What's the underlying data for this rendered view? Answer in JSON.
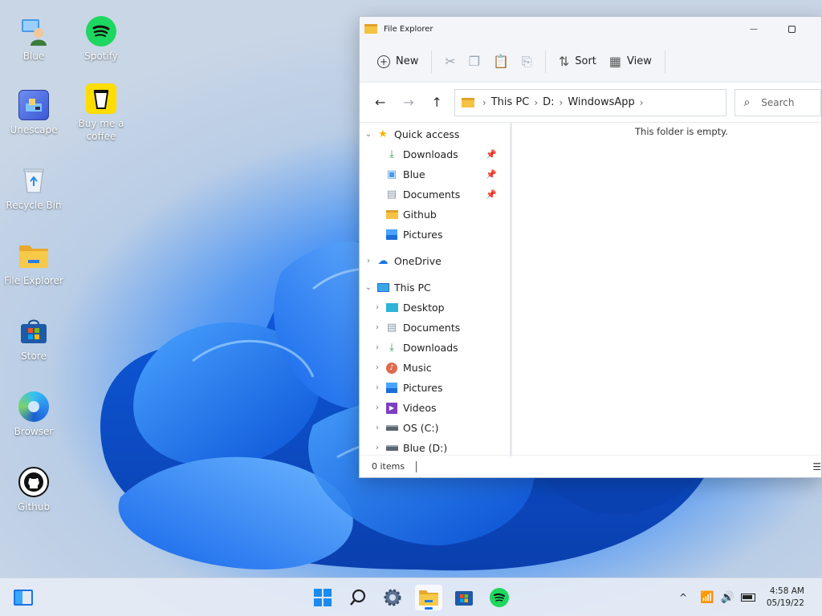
{
  "desktop": {
    "icons": [
      {
        "label": "Blue"
      },
      {
        "label": "Spotify"
      },
      {
        "label": "Unescape"
      },
      {
        "label": "Buy me a coffee"
      },
      {
        "label": "Recycle Bin"
      },
      {
        "label": "File Explorer"
      },
      {
        "label": "Store"
      },
      {
        "label": "Browser"
      },
      {
        "label": "Github"
      }
    ]
  },
  "explorer": {
    "title": "File Explorer",
    "toolbar": {
      "new": "New",
      "sort": "Sort",
      "view": "View"
    },
    "path": [
      "This PC",
      "D:",
      "WindowsApp"
    ],
    "search_placeholder": "Search",
    "quick_access": {
      "label": "Quick access",
      "items": [
        {
          "label": "Downloads",
          "pinned": true
        },
        {
          "label": "Blue",
          "pinned": true
        },
        {
          "label": "Documents",
          "pinned": true
        },
        {
          "label": "Github",
          "pinned": false
        },
        {
          "label": "Pictures",
          "pinned": false
        }
      ]
    },
    "onedrive": "OneDrive",
    "this_pc": {
      "label": "This PC",
      "items": [
        "Desktop",
        "Documents",
        "Downloads",
        "Music",
        "Pictures",
        "Videos",
        "OS (C:)",
        "Blue (D:)"
      ]
    },
    "empty_message": "This folder is empty.",
    "status": "0 items"
  },
  "taskbar": {
    "time": "4:58 AM",
    "date": "05/19/22"
  },
  "colors": {
    "accent": "#1a73e8",
    "folder": "#f5c342",
    "spotify": "#1ed760"
  }
}
